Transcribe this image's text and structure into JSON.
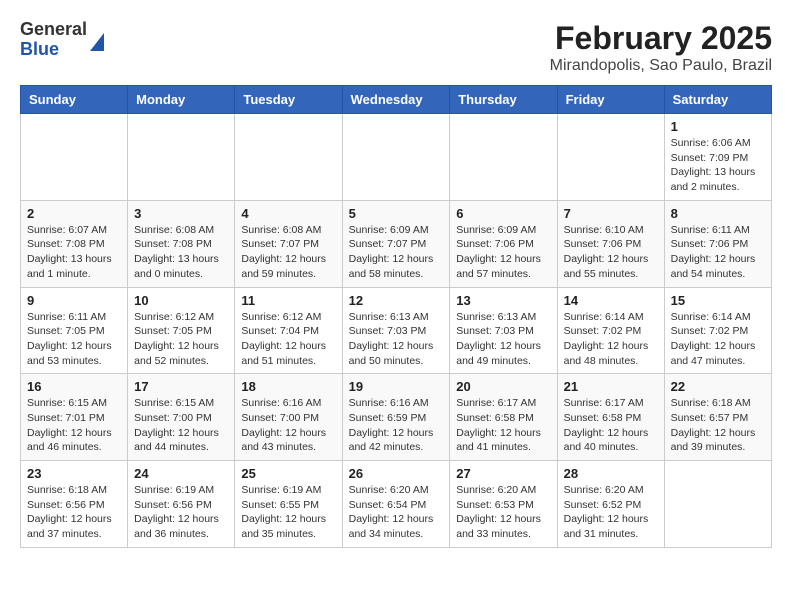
{
  "header": {
    "logo_general": "General",
    "logo_blue": "Blue",
    "title": "February 2025",
    "subtitle": "Mirandopolis, Sao Paulo, Brazil"
  },
  "weekdays": [
    "Sunday",
    "Monday",
    "Tuesday",
    "Wednesday",
    "Thursday",
    "Friday",
    "Saturday"
  ],
  "weeks": [
    [
      {
        "day": "",
        "info": ""
      },
      {
        "day": "",
        "info": ""
      },
      {
        "day": "",
        "info": ""
      },
      {
        "day": "",
        "info": ""
      },
      {
        "day": "",
        "info": ""
      },
      {
        "day": "",
        "info": ""
      },
      {
        "day": "1",
        "info": "Sunrise: 6:06 AM\nSunset: 7:09 PM\nDaylight: 13 hours\nand 2 minutes."
      }
    ],
    [
      {
        "day": "2",
        "info": "Sunrise: 6:07 AM\nSunset: 7:08 PM\nDaylight: 13 hours\nand 1 minute."
      },
      {
        "day": "3",
        "info": "Sunrise: 6:08 AM\nSunset: 7:08 PM\nDaylight: 13 hours\nand 0 minutes."
      },
      {
        "day": "4",
        "info": "Sunrise: 6:08 AM\nSunset: 7:07 PM\nDaylight: 12 hours\nand 59 minutes."
      },
      {
        "day": "5",
        "info": "Sunrise: 6:09 AM\nSunset: 7:07 PM\nDaylight: 12 hours\nand 58 minutes."
      },
      {
        "day": "6",
        "info": "Sunrise: 6:09 AM\nSunset: 7:06 PM\nDaylight: 12 hours\nand 57 minutes."
      },
      {
        "day": "7",
        "info": "Sunrise: 6:10 AM\nSunset: 7:06 PM\nDaylight: 12 hours\nand 55 minutes."
      },
      {
        "day": "8",
        "info": "Sunrise: 6:11 AM\nSunset: 7:06 PM\nDaylight: 12 hours\nand 54 minutes."
      }
    ],
    [
      {
        "day": "9",
        "info": "Sunrise: 6:11 AM\nSunset: 7:05 PM\nDaylight: 12 hours\nand 53 minutes."
      },
      {
        "day": "10",
        "info": "Sunrise: 6:12 AM\nSunset: 7:05 PM\nDaylight: 12 hours\nand 52 minutes."
      },
      {
        "day": "11",
        "info": "Sunrise: 6:12 AM\nSunset: 7:04 PM\nDaylight: 12 hours\nand 51 minutes."
      },
      {
        "day": "12",
        "info": "Sunrise: 6:13 AM\nSunset: 7:03 PM\nDaylight: 12 hours\nand 50 minutes."
      },
      {
        "day": "13",
        "info": "Sunrise: 6:13 AM\nSunset: 7:03 PM\nDaylight: 12 hours\nand 49 minutes."
      },
      {
        "day": "14",
        "info": "Sunrise: 6:14 AM\nSunset: 7:02 PM\nDaylight: 12 hours\nand 48 minutes."
      },
      {
        "day": "15",
        "info": "Sunrise: 6:14 AM\nSunset: 7:02 PM\nDaylight: 12 hours\nand 47 minutes."
      }
    ],
    [
      {
        "day": "16",
        "info": "Sunrise: 6:15 AM\nSunset: 7:01 PM\nDaylight: 12 hours\nand 46 minutes."
      },
      {
        "day": "17",
        "info": "Sunrise: 6:15 AM\nSunset: 7:00 PM\nDaylight: 12 hours\nand 44 minutes."
      },
      {
        "day": "18",
        "info": "Sunrise: 6:16 AM\nSunset: 7:00 PM\nDaylight: 12 hours\nand 43 minutes."
      },
      {
        "day": "19",
        "info": "Sunrise: 6:16 AM\nSunset: 6:59 PM\nDaylight: 12 hours\nand 42 minutes."
      },
      {
        "day": "20",
        "info": "Sunrise: 6:17 AM\nSunset: 6:58 PM\nDaylight: 12 hours\nand 41 minutes."
      },
      {
        "day": "21",
        "info": "Sunrise: 6:17 AM\nSunset: 6:58 PM\nDaylight: 12 hours\nand 40 minutes."
      },
      {
        "day": "22",
        "info": "Sunrise: 6:18 AM\nSunset: 6:57 PM\nDaylight: 12 hours\nand 39 minutes."
      }
    ],
    [
      {
        "day": "23",
        "info": "Sunrise: 6:18 AM\nSunset: 6:56 PM\nDaylight: 12 hours\nand 37 minutes."
      },
      {
        "day": "24",
        "info": "Sunrise: 6:19 AM\nSunset: 6:56 PM\nDaylight: 12 hours\nand 36 minutes."
      },
      {
        "day": "25",
        "info": "Sunrise: 6:19 AM\nSunset: 6:55 PM\nDaylight: 12 hours\nand 35 minutes."
      },
      {
        "day": "26",
        "info": "Sunrise: 6:20 AM\nSunset: 6:54 PM\nDaylight: 12 hours\nand 34 minutes."
      },
      {
        "day": "27",
        "info": "Sunrise: 6:20 AM\nSunset: 6:53 PM\nDaylight: 12 hours\nand 33 minutes."
      },
      {
        "day": "28",
        "info": "Sunrise: 6:20 AM\nSunset: 6:52 PM\nDaylight: 12 hours\nand 31 minutes."
      },
      {
        "day": "",
        "info": ""
      }
    ]
  ]
}
